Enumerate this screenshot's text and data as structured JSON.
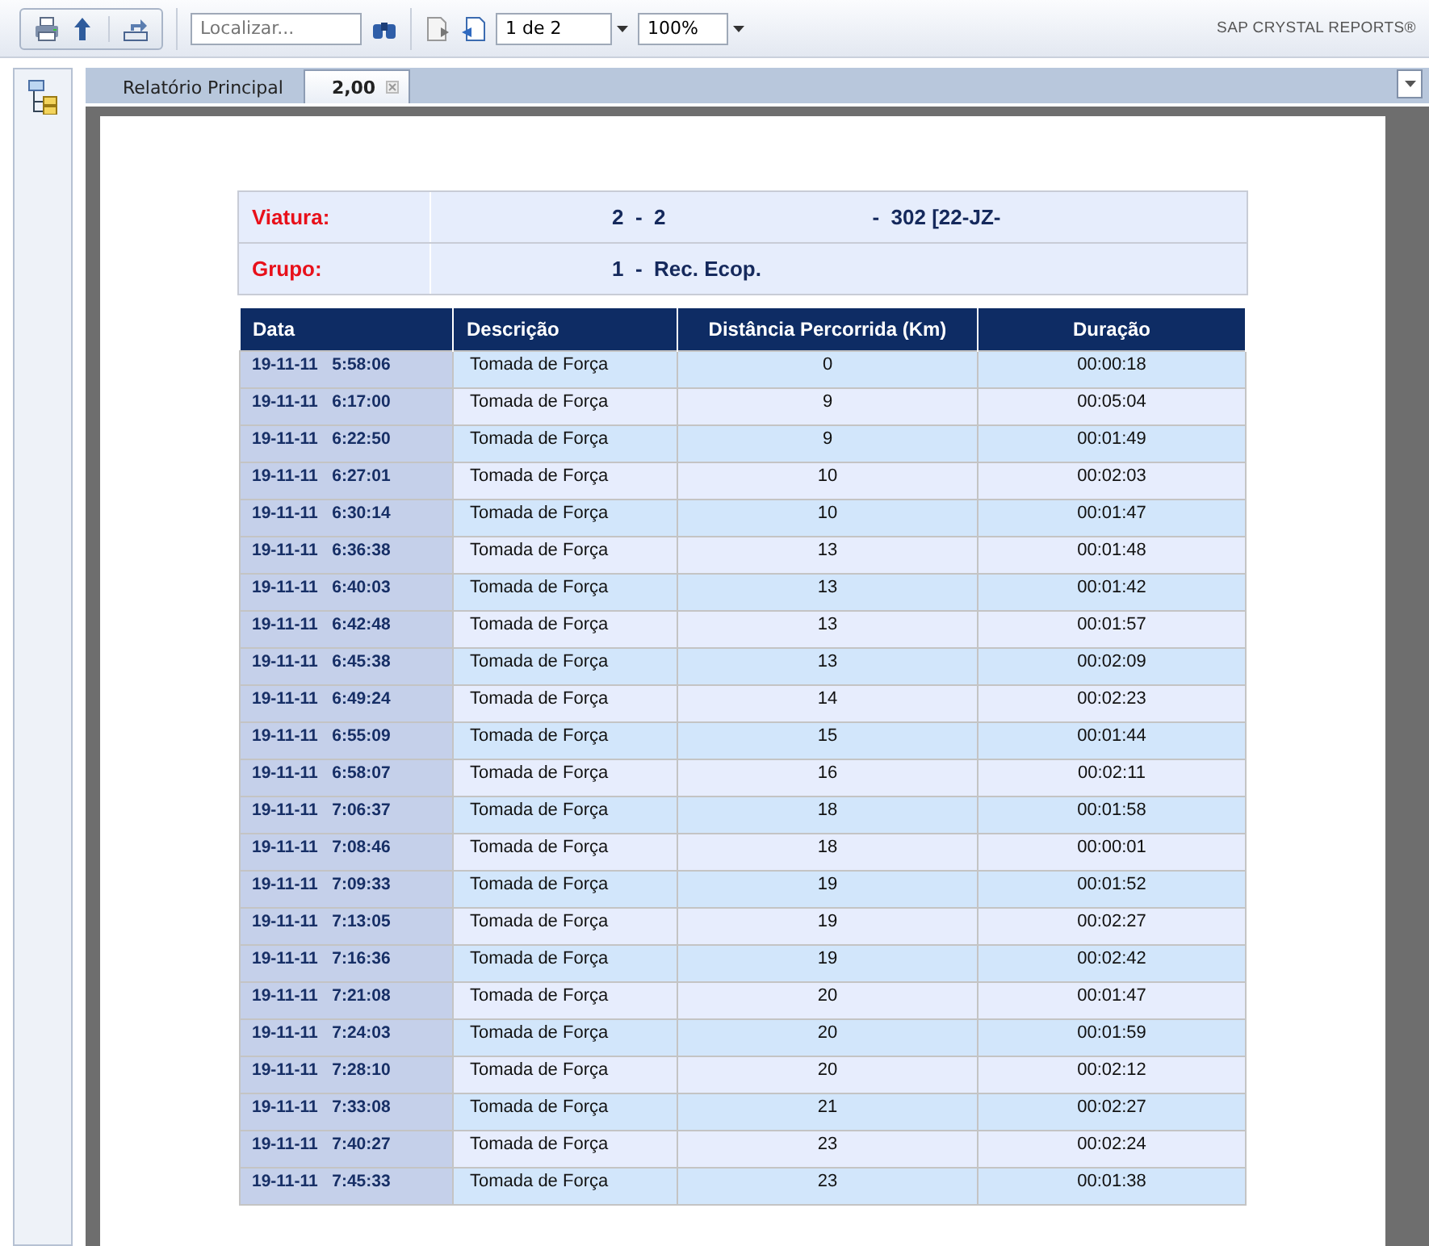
{
  "toolbar": {
    "search": {
      "placeholder": "Localizar..."
    },
    "page": {
      "value": "1 de 2"
    },
    "zoom": {
      "value": "100%"
    },
    "brand": "SAP CRYSTAL REPORTS®"
  },
  "tabs": [
    {
      "label": "Relatório Principal",
      "selected": false,
      "closable": false
    },
    {
      "label": "2,00",
      "selected": true,
      "closable": true
    }
  ],
  "report": {
    "header": [
      {
        "label": "Viatura:",
        "values": [
          "2  -  2",
          "-  302 [22-JZ-"
        ]
      },
      {
        "label": "Grupo:",
        "values": [
          "1  -  Rec. Ecop."
        ]
      }
    ],
    "table": {
      "columns": [
        "Data",
        "Descrição",
        "Distância Percorrida (Km)",
        "Duração"
      ],
      "rows": [
        [
          "19-11-11   5:58:06",
          "Tomada de Força",
          "0",
          "00:00:18"
        ],
        [
          "19-11-11   6:17:00",
          "Tomada de Força",
          "9",
          "00:05:04"
        ],
        [
          "19-11-11   6:22:50",
          "Tomada de Força",
          "9",
          "00:01:49"
        ],
        [
          "19-11-11   6:27:01",
          "Tomada de Força",
          "10",
          "00:02:03"
        ],
        [
          "19-11-11   6:30:14",
          "Tomada de Força",
          "10",
          "00:01:47"
        ],
        [
          "19-11-11   6:36:38",
          "Tomada de Força",
          "13",
          "00:01:48"
        ],
        [
          "19-11-11   6:40:03",
          "Tomada de Força",
          "13",
          "00:01:42"
        ],
        [
          "19-11-11   6:42:48",
          "Tomada de Força",
          "13",
          "00:01:57"
        ],
        [
          "19-11-11   6:45:38",
          "Tomada de Força",
          "13",
          "00:02:09"
        ],
        [
          "19-11-11   6:49:24",
          "Tomada de Força",
          "14",
          "00:02:23"
        ],
        [
          "19-11-11   6:55:09",
          "Tomada de Força",
          "15",
          "00:01:44"
        ],
        [
          "19-11-11   6:58:07",
          "Tomada de Força",
          "16",
          "00:02:11"
        ],
        [
          "19-11-11   7:06:37",
          "Tomada de Força",
          "18",
          "00:01:58"
        ],
        [
          "19-11-11   7:08:46",
          "Tomada de Força",
          "18",
          "00:00:01"
        ],
        [
          "19-11-11   7:09:33",
          "Tomada de Força",
          "19",
          "00:01:52"
        ],
        [
          "19-11-11   7:13:05",
          "Tomada de Força",
          "19",
          "00:02:27"
        ],
        [
          "19-11-11   7:16:36",
          "Tomada de Força",
          "19",
          "00:02:42"
        ],
        [
          "19-11-11   7:21:08",
          "Tomada de Força",
          "20",
          "00:01:47"
        ],
        [
          "19-11-11   7:24:03",
          "Tomada de Força",
          "20",
          "00:01:59"
        ],
        [
          "19-11-11   7:28:10",
          "Tomada de Força",
          "20",
          "00:02:12"
        ],
        [
          "19-11-11   7:33:08",
          "Tomada de Força",
          "21",
          "00:02:27"
        ],
        [
          "19-11-11   7:40:27",
          "Tomada de Força",
          "23",
          "00:02:24"
        ],
        [
          "19-11-11   7:45:33",
          "Tomada de Força",
          "23",
          "00:01:38"
        ]
      ]
    }
  }
}
